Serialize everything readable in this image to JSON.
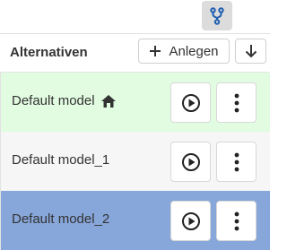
{
  "toolbar": {
    "branch_icon": "branch-fork-icon"
  },
  "panel": {
    "title": "Alternativen",
    "add_label": "Anlegen",
    "add_icon": "plus-icon",
    "sort_icon": "arrow-down-icon"
  },
  "rows": [
    {
      "label": "Default model",
      "home_icon": "home-icon",
      "background": "#e2fce1",
      "selected": false,
      "is_default": true
    },
    {
      "label": "Default model_1",
      "background": "#f6f6f6",
      "selected": false,
      "is_default": false
    },
    {
      "label": "Default model_2",
      "background": "#87a6d9",
      "selected": true,
      "is_default": false
    }
  ],
  "colors": {
    "default_row": "#e2fce1",
    "normal_row": "#f6f6f6",
    "selected_row": "#87a6d9",
    "toolbar_button": "#dcdcdc"
  }
}
